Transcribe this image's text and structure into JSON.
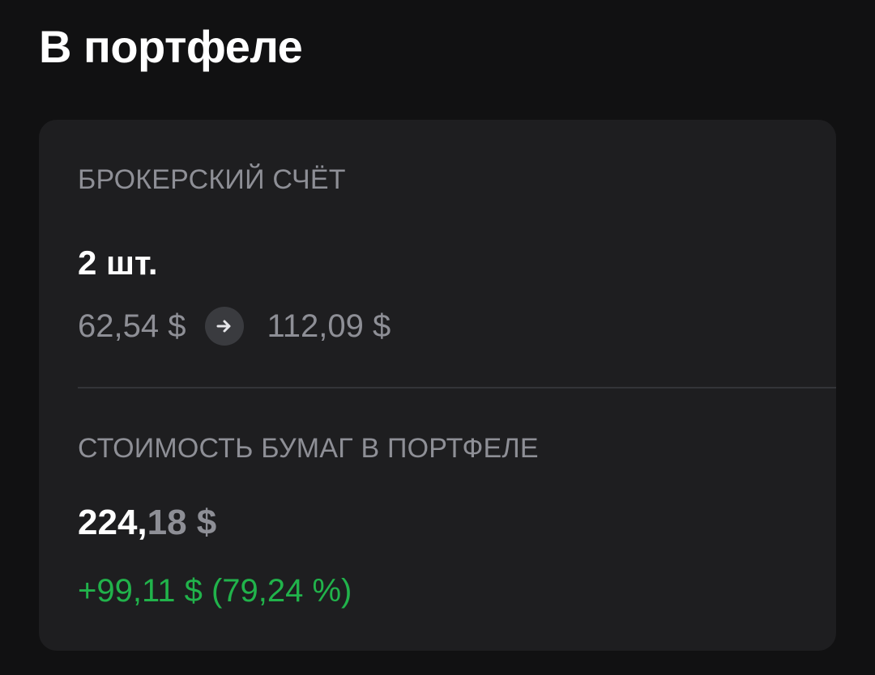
{
  "page": {
    "title": "В портфеле"
  },
  "broker": {
    "label": "БРОКЕРСКИЙ СЧЁТ",
    "quantity": "2 шт.",
    "price_from": "62,54 $",
    "arrow_icon": "arrow-right-icon",
    "price_to": "112,09 $"
  },
  "value": {
    "label": "СТОИМОСТЬ БУМАГ В ПОРТФЕЛЕ",
    "total_integer": "224,",
    "total_fraction": "18 $",
    "change": "+99,11 $ (79,24 %)"
  },
  "colors": {
    "background": "#111112",
    "card": "#1e1e20",
    "muted_text": "#8e8f96",
    "positive": "#21b34b"
  }
}
